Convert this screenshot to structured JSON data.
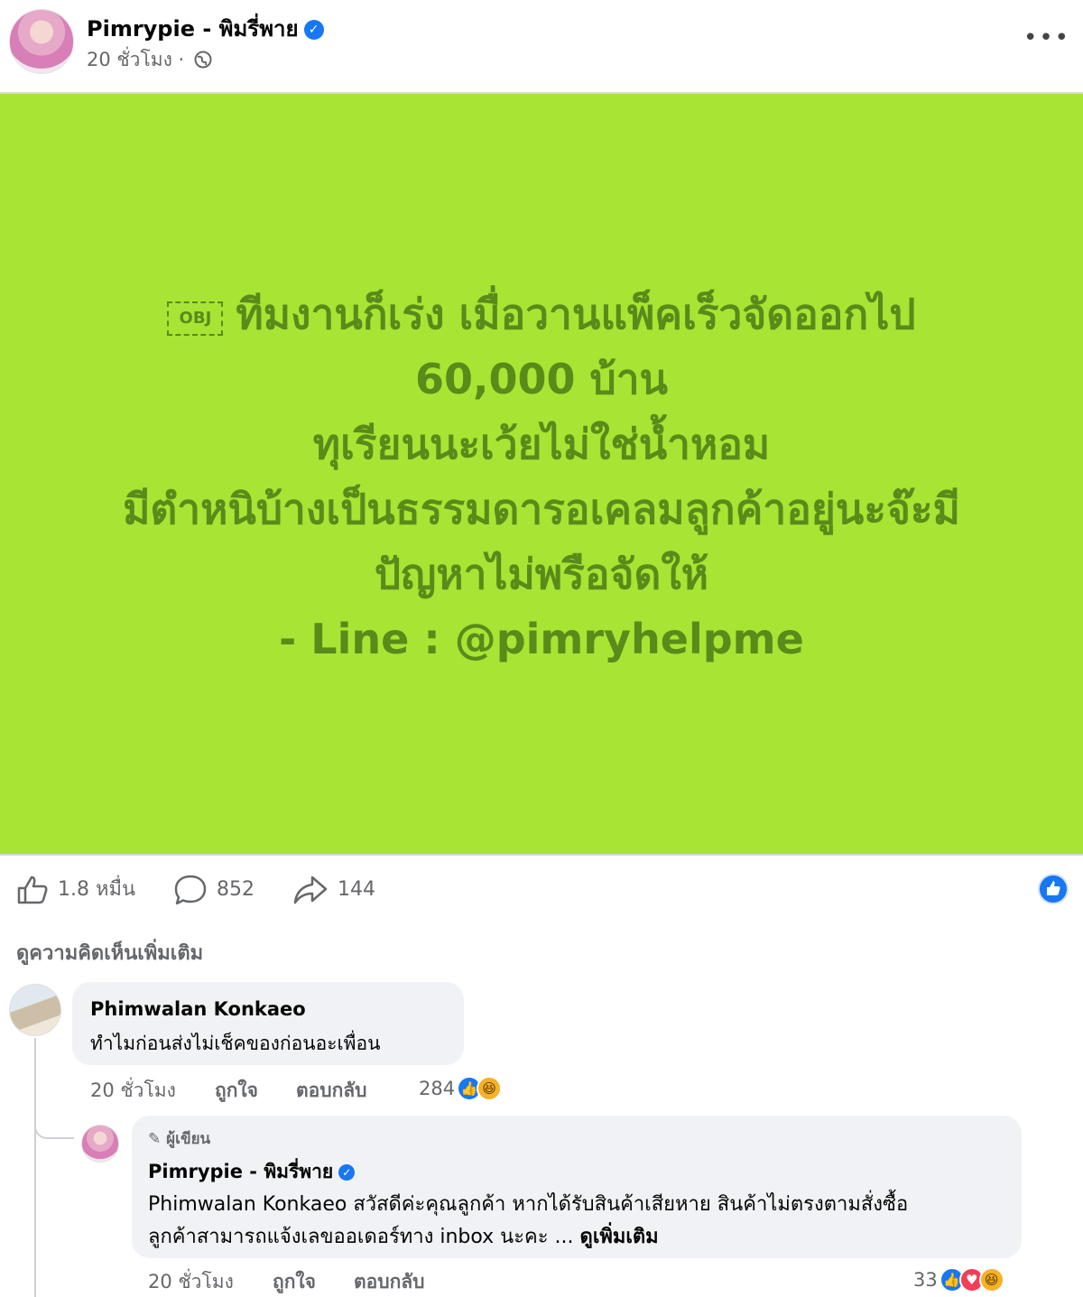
{
  "post": {
    "page_name": "Pimrypie - พิมรี่พาย",
    "time": "20 ชั่วโมง ·",
    "icons": {
      "verified": "verified-badge-icon",
      "privacy": "globe-icon",
      "more": "more-options-icon"
    },
    "obj_glyph": "OBJ",
    "lines": [
      "ทีมงานก็เร่ง เมื่อวานแพ็คเร็วจัดออกไป",
      "60,000 บ้าน",
      "ทุเรียนนะเว้ยไม่ใช่น้ำหอม",
      "มีตำหนิบ้างเป็นธรรมดารอเคลมลูกค้าอยู่นะจ๊ะมี",
      "ปัญหาไม่พรือจัดให้",
      "- Line : @pimryhelpme"
    ],
    "background_color": "#a8e433",
    "text_color": "#5a8a1a"
  },
  "stats": {
    "likes": "1.8 หมื่น",
    "comments": "852",
    "shares": "144"
  },
  "comments_section": {
    "more_comments_label": "ดูความคิดเห็นเพิ่มเติม",
    "comment": {
      "author": "Phimwalan Konkaeo",
      "text": "ทำไมก่อนส่งไม่เช็คของก่อนอะเพื่อน",
      "time": "20 ชั่วโมง",
      "like_label": "ถูกใจ",
      "reply_label": "ตอบกลับ",
      "reaction_count": "284"
    },
    "reply": {
      "author_tag": "ผู้เขียน",
      "author": "Pimrypie - พิมรี่พาย",
      "line1": "Phimwalan Konkaeo สวัสดีค่ะคุณลูกค้า หากได้รับสินค้าเสียหาย สินค้าไม่ตรงตามสั่งซื้อ",
      "line2": "ลูกค้าสามารถแจ้งเลขออเดอร์ทาง inbox นะคะ ...",
      "see_more": "ดูเพิ่มเติม",
      "time": "20 ชั่วโมง",
      "like_label": "ถูกใจ",
      "reply_label": "ตอบกลับ",
      "reaction_count": "33"
    }
  }
}
